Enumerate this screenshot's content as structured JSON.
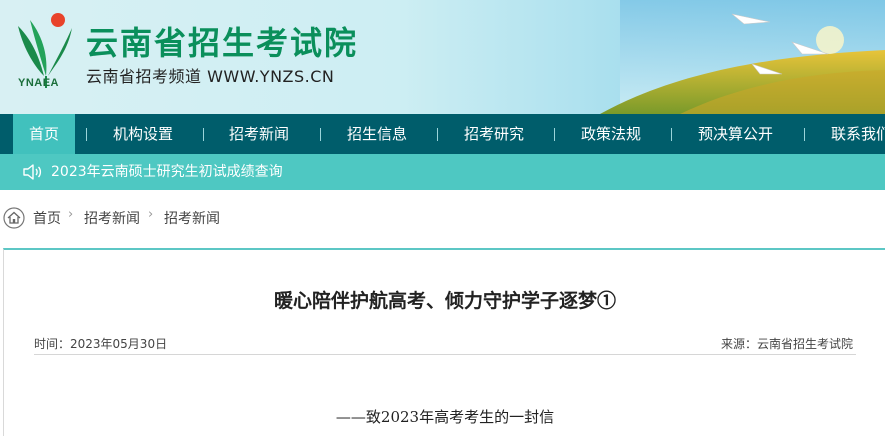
{
  "header": {
    "logo_text": "YNAEA",
    "site_title": "云南省招生考试院",
    "site_subtitle": "云南省招考频道  WWW.YNZS.CN"
  },
  "nav": {
    "items": [
      {
        "label": "首页",
        "active": true
      },
      {
        "label": "机构设置"
      },
      {
        "label": "招考新闻"
      },
      {
        "label": "招生信息"
      },
      {
        "label": "招考研究"
      },
      {
        "label": "政策法规"
      },
      {
        "label": "预决算公开"
      },
      {
        "label": "联系我们"
      }
    ]
  },
  "notice": {
    "icon": "speaker-icon",
    "text": "2023年云南硕士研究生初试成绩查询"
  },
  "breadcrumb": {
    "icon": "home-icon",
    "items": [
      "首页",
      "招考新闻",
      "招考新闻"
    ]
  },
  "article": {
    "title": "暖心陪伴护航高考、倾力守护学子逐梦①",
    "time": "时间：2023年05月30日",
    "source": "来源：云南省招生考试院",
    "subtitle": "——致2023年高考考生的一封信"
  },
  "colors": {
    "nav_bg": "#005d6b",
    "nav_active": "#41c1bd",
    "notice_bg": "#4ec8c2",
    "title_green": "#0a8f5b",
    "panel_border": "#5cc7c5"
  }
}
